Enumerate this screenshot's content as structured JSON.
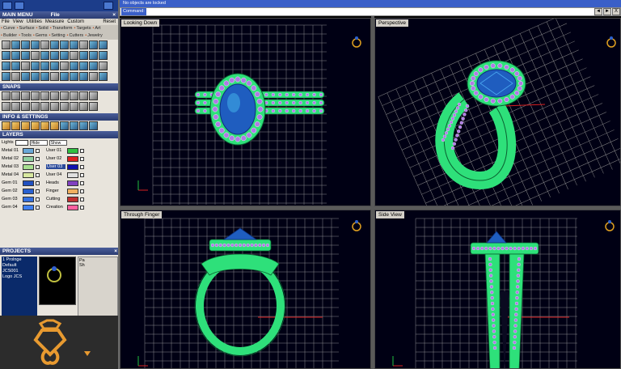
{
  "left_panel": {
    "main_menu_title": "MAIN MENU",
    "main_menu_file": "File",
    "menubar": [
      "File",
      "View",
      "Utilities",
      "Measure",
      "Custom",
      "Reset"
    ],
    "tabs": [
      "Curve",
      "Surface",
      "Solid",
      "Transform",
      "Targets",
      "Art"
    ],
    "tabs2": [
      "Builder",
      "Tools",
      "Gems",
      "Setting",
      "Cutters",
      "Jewelry"
    ],
    "snaps_title": "SNAPS",
    "info_title": "INFO & SETTINGS",
    "layers_title": "LAYERS",
    "layers_header": {
      "lights": "Lights",
      "hide": "Hide",
      "show": "Show"
    },
    "layers_left": [
      "Metal 01",
      "Metal 02",
      "Metal 03",
      "Metal 04",
      "Gem 01",
      "Gem 02",
      "Gem 03",
      "Gem 04"
    ],
    "layers_right": [
      "User 01",
      "User 02",
      "User 03",
      "User 04",
      "Heads",
      "Finger",
      "Cutting",
      "Creation"
    ],
    "projects_title": "PROJECTS",
    "projects_list": [
      "1 Prolnge",
      "Default",
      "JCS001",
      "Logo JCS"
    ],
    "projects_side": "Pa",
    "projects_side2": "Sh"
  },
  "command": {
    "message": "No objects are locked",
    "label": "Command:",
    "buttons": [
      "◄",
      "►",
      "X"
    ]
  },
  "viewports": [
    {
      "title": "Looking Down"
    },
    {
      "title": "Perspective"
    },
    {
      "title": "Through Finger"
    },
    {
      "title": "Side View"
    }
  ],
  "colors": {
    "metal": "#2ee07a",
    "gem": "#1f5dbf",
    "accent_stones": "#b07ae6",
    "grid": "#8a8a8a",
    "axis_red": "#d82020",
    "axis_green": "#20c040",
    "ring_icon": "#e0a020"
  }
}
